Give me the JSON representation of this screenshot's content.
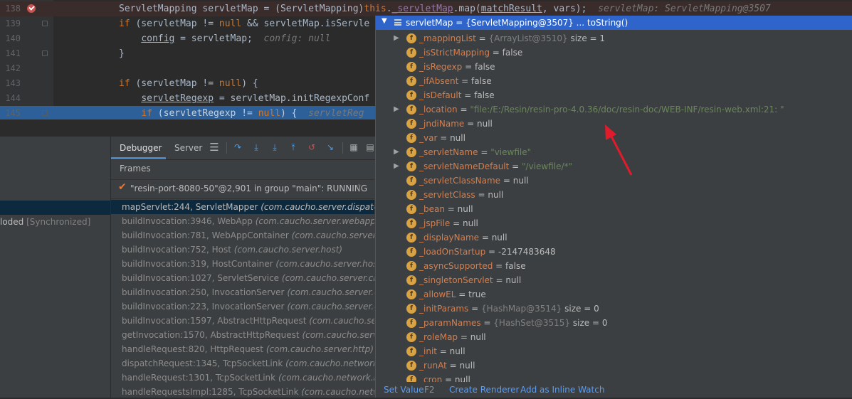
{
  "editor": {
    "lines": [
      {
        "no": "138",
        "parts": [
          {
            "t": "ServletMapping servletMap = (ServletMapping)",
            "c": ""
          },
          {
            "t": "this",
            "c": "kw"
          },
          {
            "t": ".",
            "c": ""
          },
          {
            "t": "_servletMap",
            "c": "fld under"
          },
          {
            "t": ".map(",
            "c": ""
          },
          {
            "t": "matchResult",
            "c": "under"
          },
          {
            "t": ", vars);  ",
            "c": ""
          },
          {
            "t": "servletMap: ServletMapping@3507",
            "c": "hint"
          }
        ]
      },
      {
        "no": "139",
        "parts": [
          {
            "t": "if",
            "c": "kw"
          },
          {
            "t": " (servletMap != ",
            "c": ""
          },
          {
            "t": "null",
            "c": "kw"
          },
          {
            "t": " && servletMap.isServle",
            "c": ""
          }
        ]
      },
      {
        "no": "140",
        "parts": [
          {
            "t": "    ",
            "c": ""
          },
          {
            "t": "config",
            "c": "under"
          },
          {
            "t": " = servletMap;  ",
            "c": ""
          },
          {
            "t": "config: null",
            "c": "hint"
          }
        ]
      },
      {
        "no": "141",
        "parts": [
          {
            "t": "}",
            "c": ""
          }
        ]
      },
      {
        "no": "142",
        "parts": []
      },
      {
        "no": "143",
        "parts": [
          {
            "t": "if",
            "c": "kw"
          },
          {
            "t": " (servletMap != ",
            "c": ""
          },
          {
            "t": "null",
            "c": "kw"
          },
          {
            "t": ") {",
            "c": ""
          }
        ]
      },
      {
        "no": "144",
        "parts": [
          {
            "t": "    ",
            "c": ""
          },
          {
            "t": "servletRegexp",
            "c": "under"
          },
          {
            "t": " = servletMap.initRegexpConf",
            "c": ""
          }
        ]
      },
      {
        "no": "145",
        "parts": [
          {
            "t": "    ",
            "c": ""
          },
          {
            "t": "if",
            "c": "kw"
          },
          {
            "t": " (servletRegexp != ",
            "c": ""
          },
          {
            "t": "null",
            "c": "kw"
          },
          {
            "t": ") {  ",
            "c": ""
          },
          {
            "t": "servletReg",
            "c": "hint"
          }
        ]
      }
    ]
  },
  "debugger": {
    "tabs": [
      "Debugger",
      "Server"
    ],
    "frames_header": "Frames",
    "thread": "\"resin-port-8080-50\"@2,901 in group \"main\": RUNNING",
    "left_status": "loded",
    "left_status_suffix": "[Synchronized]",
    "frames": [
      {
        "fn": "mapServlet:244, ServletMapper",
        "pkg": "(com.caucho.server.dispatch)"
      },
      {
        "fn": "buildInvocation:3946, WebApp",
        "pkg": "(com.caucho.server.webapp)"
      },
      {
        "fn": "buildInvocation:781, WebAppContainer",
        "pkg": "(com.caucho.server.webapp)"
      },
      {
        "fn": "buildInvocation:752, Host",
        "pkg": "(com.caucho.server.host)"
      },
      {
        "fn": "buildInvocation:319, HostContainer",
        "pkg": "(com.caucho.server.host)"
      },
      {
        "fn": "buildInvocation:1027, ServletService",
        "pkg": "(com.caucho.server.cluster)"
      },
      {
        "fn": "buildInvocation:250, InvocationServer",
        "pkg": "(com.caucho.server.dispatch)"
      },
      {
        "fn": "buildInvocation:223, InvocationServer",
        "pkg": "(com.caucho.server.dispatch)"
      },
      {
        "fn": "buildInvocation:1597, AbstractHttpRequest",
        "pkg": "(com.caucho.server.http)"
      },
      {
        "fn": "getInvocation:1570, AbstractHttpRequest",
        "pkg": "(com.caucho.server.http)"
      },
      {
        "fn": "handleRequest:820, HttpRequest",
        "pkg": "(com.caucho.server.http)"
      },
      {
        "fn": "dispatchRequest:1345, TcpSocketLink",
        "pkg": "(com.caucho.network.listen)"
      },
      {
        "fn": "handleRequest:1301, TcpSocketLink",
        "pkg": "(com.caucho.network.listen)"
      },
      {
        "fn": "handleRequestsImpl:1285, TcpSocketLink",
        "pkg": "(com.caucho.network.listen)"
      }
    ]
  },
  "popup": {
    "header": "servletMap = {ServletMapping@3507} ... toString()",
    "fields": [
      {
        "name": "_mappingList",
        "value": "{ArrayList@3510}",
        "vtype": "ref",
        "extra": "size = 1",
        "expandable": true
      },
      {
        "name": "_isStrictMapping",
        "value": "false",
        "vtype": "plain",
        "expandable": false
      },
      {
        "name": "_isRegexp",
        "value": "false",
        "vtype": "plain",
        "expandable": false
      },
      {
        "name": "_ifAbsent",
        "value": "false",
        "vtype": "plain",
        "expandable": false
      },
      {
        "name": "_isDefault",
        "value": "false",
        "vtype": "plain",
        "expandable": false
      },
      {
        "name": "_location",
        "value": "\"file:/E:/Resin/resin-pro-4.0.36/doc/resin-doc/WEB-INF/resin-web.xml:21: \"",
        "vtype": "str",
        "expandable": true
      },
      {
        "name": "_jndiName",
        "value": "null",
        "vtype": "plain",
        "expandable": false
      },
      {
        "name": "_var",
        "value": "null",
        "vtype": "plain",
        "expandable": false
      },
      {
        "name": "_servletName",
        "value": "\"viewfile\"",
        "vtype": "str",
        "expandable": true
      },
      {
        "name": "_servletNameDefault",
        "value": "\"/viewfile/*\"",
        "vtype": "str",
        "expandable": true
      },
      {
        "name": "_servletClassName",
        "value": "null",
        "vtype": "plain",
        "expandable": false
      },
      {
        "name": "_servletClass",
        "value": "null",
        "vtype": "plain",
        "expandable": false
      },
      {
        "name": "_bean",
        "value": "null",
        "vtype": "plain",
        "expandable": false
      },
      {
        "name": "_jspFile",
        "value": "null",
        "vtype": "plain",
        "expandable": false
      },
      {
        "name": "_displayName",
        "value": "null",
        "vtype": "plain",
        "expandable": false
      },
      {
        "name": "_loadOnStartup",
        "value": "-2147483648",
        "vtype": "plain",
        "expandable": false
      },
      {
        "name": "_asyncSupported",
        "value": "false",
        "vtype": "plain",
        "expandable": false
      },
      {
        "name": "_singletonServlet",
        "value": "null",
        "vtype": "plain",
        "expandable": false
      },
      {
        "name": "_allowEL",
        "value": "true",
        "vtype": "plain",
        "expandable": false
      },
      {
        "name": "_initParams",
        "value": "{HashMap@3514}",
        "vtype": "ref",
        "extra": "size = 0",
        "expandable": false
      },
      {
        "name": "_paramNames",
        "value": "{HashSet@3515}",
        "vtype": "ref",
        "extra": "size = 0",
        "expandable": false
      },
      {
        "name": "_roleMap",
        "value": "null",
        "vtype": "plain",
        "expandable": false
      },
      {
        "name": "_init",
        "value": "null",
        "vtype": "plain",
        "expandable": false
      },
      {
        "name": "_runAt",
        "value": "null",
        "vtype": "plain",
        "expandable": false
      },
      {
        "name": "_cron",
        "value": "null",
        "vtype": "plain",
        "expandable": false
      }
    ],
    "footer": {
      "set_value": "Set Value",
      "set_value_key": "F2",
      "create_renderer": "Create Renderer",
      "add_inline_watch": "Add as Inline Watch"
    }
  },
  "colors": {
    "accent": "#2f65ca",
    "annotation_arrow": "#e01b2c",
    "field_icon": "#d9a343"
  }
}
